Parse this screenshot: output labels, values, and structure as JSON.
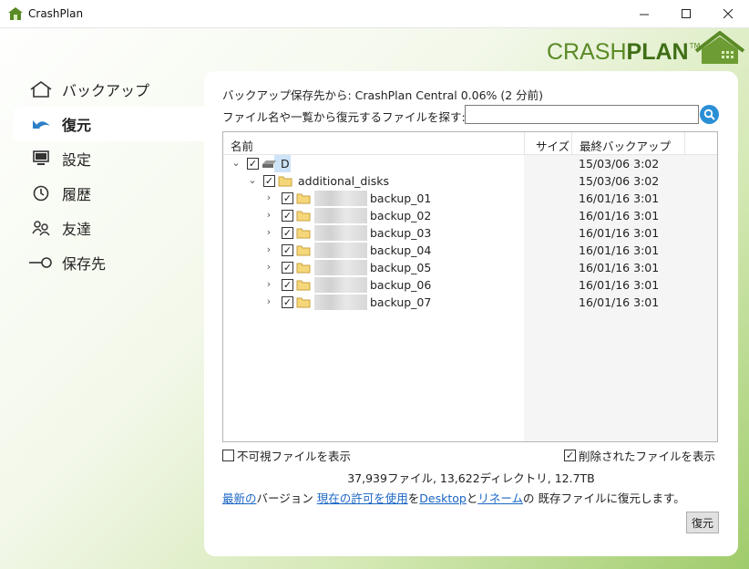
{
  "window": {
    "title": "CrashPlan",
    "minimize_icon": "minimize-icon",
    "maximize_icon": "maximize-icon",
    "close_icon": "close-icon"
  },
  "logo": {
    "part1": "CRASH",
    "part2": "PLAN",
    "tm": "TM"
  },
  "colors": {
    "brand_green": "#5a8a26",
    "link_blue": "#1a66c4",
    "search_blue": "#2b8fd6"
  },
  "sidebar": {
    "items": [
      {
        "label": "バックアップ",
        "icon": "house-icon"
      },
      {
        "label": "復元",
        "icon": "restore-arrow-icon"
      },
      {
        "label": "設定",
        "icon": "monitor-icon"
      },
      {
        "label": "履歴",
        "icon": "clock-icon"
      },
      {
        "label": "友達",
        "icon": "people-icon"
      },
      {
        "label": "保存先",
        "icon": "destination-icon"
      }
    ]
  },
  "main": {
    "source_line": "バックアップ保存先から: CrashPlan Central  0.06%  (2 分前)",
    "search_label": "ファイル名や一覧から復元するファイルを探す:",
    "search_value": "",
    "columns": {
      "name": "名前",
      "size": "サイズ",
      "last_backup": "最終バックアップ"
    },
    "tree": [
      {
        "name": "D",
        "date": "15/03/06 3:02"
      },
      {
        "name": "additional_disks",
        "date": "15/03/06 3:02"
      },
      {
        "name": "backup_01",
        "date": "16/01/16 3:01"
      },
      {
        "name": "backup_02",
        "date": "16/01/16 3:01"
      },
      {
        "name": "backup_03",
        "date": "16/01/16 3:01"
      },
      {
        "name": "backup_04",
        "date": "16/01/16 3:01"
      },
      {
        "name": "backup_05",
        "date": "16/01/16 3:01"
      },
      {
        "name": "backup_06",
        "date": "16/01/16 3:01"
      },
      {
        "name": "backup_07",
        "date": "16/01/16 3:01"
      }
    ],
    "show_hidden": "不可視ファイルを表示",
    "show_deleted": "削除されたファイルを表示",
    "stats": "37,939ファイル, 13,622ディレクトリ, 12.7TB",
    "links": {
      "latest": "最新の",
      "version": "バージョン",
      "permission": "現在の許可を使用",
      "wo": "を",
      "desktop": "Desktop",
      "to": "と",
      "rename": "リネーム",
      "tail": "の 既存ファイルに復元します。"
    },
    "restore_button": "復元"
  }
}
